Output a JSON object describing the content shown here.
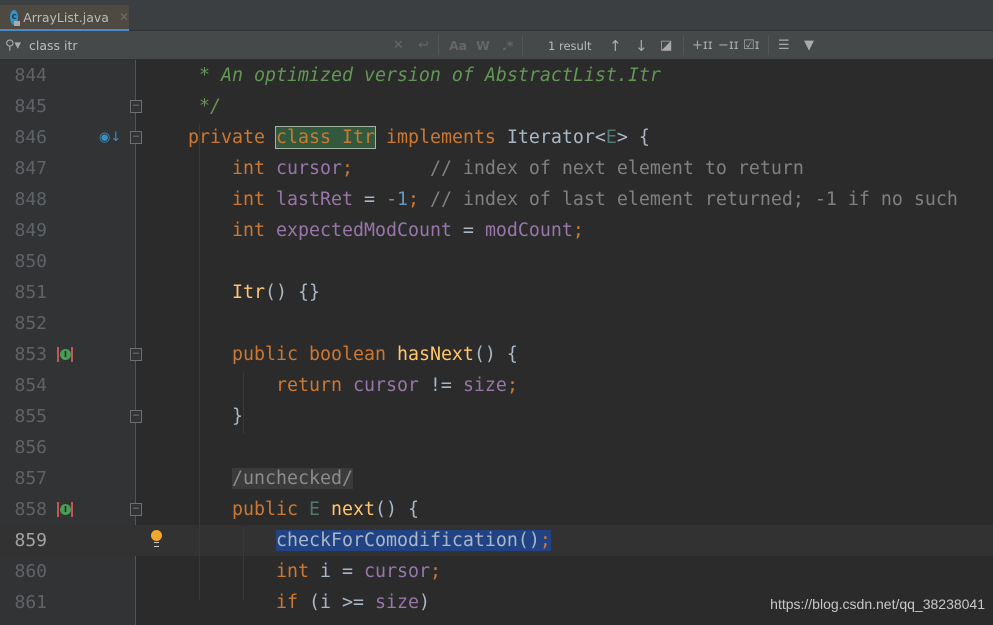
{
  "tab": {
    "label": "ArrayList.java",
    "icon": "java-class-icon"
  },
  "search": {
    "query": "class itr",
    "result": "1 result",
    "match_case": "Aa",
    "words": "W",
    "regex": ".*"
  },
  "current_line": 859,
  "lines": [
    {
      "n": 844,
      "tokens": [
        [
          " * An optimized version of AbstractList.Itr",
          "cm"
        ]
      ]
    },
    {
      "n": 845,
      "fold": "end",
      "tokens": [
        [
          " */",
          "cm"
        ]
      ]
    },
    {
      "n": 846,
      "fold": "start",
      "marker": "overridden",
      "tokens": [
        [
          "private ",
          "kw"
        ],
        [
          "class Itr",
          "hl-kw"
        ],
        [
          " implements ",
          "kw"
        ],
        [
          "Iterator<",
          ""
        ],
        [
          "E",
          "tp"
        ],
        [
          "> {",
          ""
        ]
      ]
    },
    {
      "n": 847,
      "tokens": [
        [
          "    int ",
          "kw"
        ],
        [
          "cursor",
          "fld"
        ],
        [
          ";",
          "kw"
        ],
        [
          "       // index of next element to return",
          "lc"
        ]
      ]
    },
    {
      "n": 848,
      "tokens": [
        [
          "    int ",
          "kw"
        ],
        [
          "lastRet",
          "fld"
        ],
        [
          " = ",
          ""
        ],
        [
          "-1",
          "num"
        ],
        [
          ";",
          "kw"
        ],
        [
          " // index of last element returned; -1 if no such",
          "lc"
        ]
      ]
    },
    {
      "n": 849,
      "tokens": [
        [
          "    int ",
          "kw"
        ],
        [
          "expectedModCount",
          "fld"
        ],
        [
          " = ",
          ""
        ],
        [
          "modCount",
          "fld"
        ],
        [
          ";",
          "kw"
        ]
      ]
    },
    {
      "n": 850,
      "tokens": []
    },
    {
      "n": 851,
      "tokens": [
        [
          "    ",
          ""
        ],
        [
          "Itr",
          "fn"
        ],
        [
          "() {}",
          ""
        ]
      ]
    },
    {
      "n": 852,
      "tokens": []
    },
    {
      "n": 853,
      "fold": "start",
      "marker": "implements",
      "tokens": [
        [
          "    public boolean ",
          "kw"
        ],
        [
          "hasNext",
          "fn"
        ],
        [
          "() {",
          ""
        ]
      ]
    },
    {
      "n": 854,
      "tokens": [
        [
          "        return ",
          "kw"
        ],
        [
          "cursor",
          "fld"
        ],
        [
          " != ",
          ""
        ],
        [
          "size",
          "fld"
        ],
        [
          ";",
          "kw"
        ]
      ]
    },
    {
      "n": 855,
      "fold": "end",
      "tokens": [
        [
          "    }",
          ""
        ]
      ]
    },
    {
      "n": 856,
      "tokens": []
    },
    {
      "n": 857,
      "tokens": [
        [
          "    ",
          ""
        ],
        [
          "/unchecked/",
          "ann"
        ]
      ]
    },
    {
      "n": 858,
      "fold": "start",
      "marker": "implements",
      "tokens": [
        [
          "    public ",
          "kw"
        ],
        [
          "E ",
          "tp"
        ],
        [
          "next",
          "fn"
        ],
        [
          "() {",
          ""
        ]
      ]
    },
    {
      "n": 859,
      "bulb": true,
      "tokens": [
        [
          "        ",
          ""
        ],
        [
          "checkForComodification()",
          "sel"
        ],
        [
          ";",
          "sel-kw"
        ]
      ]
    },
    {
      "n": 860,
      "tokens": [
        [
          "        int ",
          "kw"
        ],
        [
          "i = ",
          ""
        ],
        [
          "cursor",
          "fld"
        ],
        [
          ";",
          "kw"
        ]
      ]
    },
    {
      "n": 861,
      "tokens": [
        [
          "        if ",
          "kw"
        ],
        [
          "(i >= ",
          ""
        ],
        [
          "size",
          "fld"
        ],
        [
          ")",
          ""
        ]
      ]
    }
  ],
  "watermark": "https://blog.csdn.net/qq_38238041"
}
